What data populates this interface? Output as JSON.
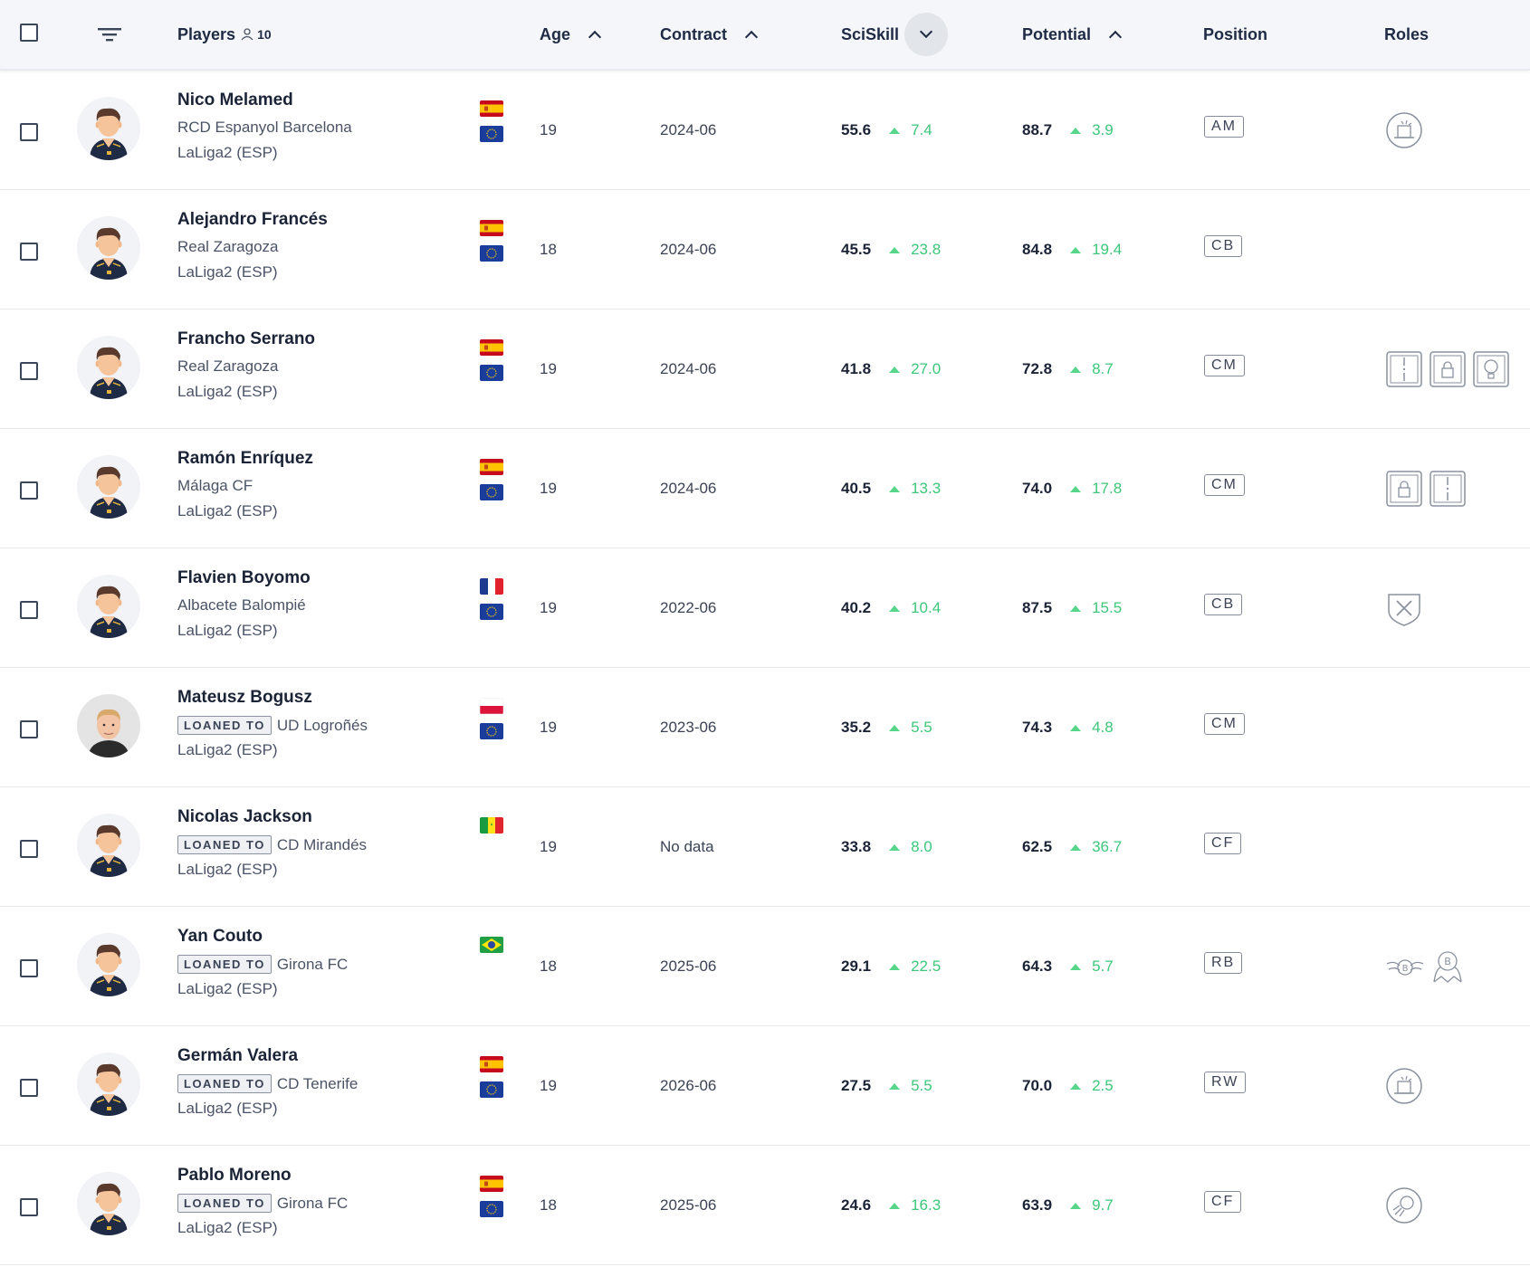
{
  "header": {
    "players_label": "Players",
    "players_count": "10",
    "age_label": "Age",
    "contract_label": "Contract",
    "sciskill_label": "SciSkill",
    "potential_label": "Potential",
    "position_label": "Position",
    "roles_label": "Roles"
  },
  "loan_label": "LOANED TO",
  "rows": [
    {
      "name": "Nico Melamed",
      "club": "RCD Espanyol Barcelona",
      "loaned": false,
      "league": "LaLiga2 (ESP)",
      "flags": [
        "spain-flag",
        "eu-flag"
      ],
      "age": "19",
      "contract": "2024-06",
      "sciskill": "55.6",
      "sciskill_delta": "7.4",
      "potential": "88.7",
      "potential_delta": "3.9",
      "position": "AM",
      "roles": [
        "magician-hat-icon"
      ]
    },
    {
      "name": "Alejandro Francés",
      "club": "Real Zaragoza",
      "loaned": false,
      "league": "LaLiga2 (ESP)",
      "flags": [
        "spain-flag",
        "eu-flag"
      ],
      "age": "18",
      "contract": "2024-06",
      "sciskill": "45.5",
      "sciskill_delta": "23.8",
      "potential": "84.8",
      "potential_delta": "19.4",
      "position": "CB",
      "roles": []
    },
    {
      "name": "Francho Serrano",
      "club": "Real Zaragoza",
      "loaned": false,
      "league": "LaLiga2 (ESP)",
      "flags": [
        "spain-flag",
        "eu-flag"
      ],
      "age": "19",
      "contract": "2024-06",
      "sciskill": "41.8",
      "sciskill_delta": "27.0",
      "potential": "72.8",
      "potential_delta": "8.7",
      "position": "CM",
      "roles": [
        "pitch-line-icon",
        "lock-icon",
        "lightbulb-icon"
      ]
    },
    {
      "name": "Ramón Enríquez",
      "club": "Málaga CF",
      "loaned": false,
      "league": "LaLiga2 (ESP)",
      "flags": [
        "spain-flag",
        "eu-flag"
      ],
      "age": "19",
      "contract": "2024-06",
      "sciskill": "40.5",
      "sciskill_delta": "13.3",
      "potential": "74.0",
      "potential_delta": "17.8",
      "position": "CM",
      "roles": [
        "lock-icon",
        "pitch-line-icon"
      ]
    },
    {
      "name": "Flavien Boyomo",
      "club": "Albacete Balompié",
      "loaned": false,
      "league": "LaLiga2 (ESP)",
      "flags": [
        "france-flag",
        "eu-flag"
      ],
      "age": "19",
      "contract": "2022-06",
      "sciskill": "40.2",
      "sciskill_delta": "10.4",
      "potential": "87.5",
      "potential_delta": "15.5",
      "position": "CB",
      "roles": [
        "shield-crossed-icon"
      ]
    },
    {
      "name": "Mateusz Bogusz",
      "club": "UD Logroñés",
      "loaned": true,
      "league": "LaLiga2 (ESP)",
      "flags": [
        "poland-flag",
        "eu-flag"
      ],
      "age": "19",
      "contract": "2023-06",
      "sciskill": "35.2",
      "sciskill_delta": "5.5",
      "potential": "74.3",
      "potential_delta": "4.8",
      "position": "CM",
      "roles": [],
      "photo": true
    },
    {
      "name": "Nicolas Jackson",
      "club": "CD Mirandés",
      "loaned": true,
      "league": "LaLiga2 (ESP)",
      "flags": [
        "senegal-flag"
      ],
      "age": "19",
      "contract": "No data",
      "sciskill": "33.8",
      "sciskill_delta": "8.0",
      "potential": "62.5",
      "potential_delta": "36.7",
      "position": "CF",
      "roles": []
    },
    {
      "name": "Yan Couto",
      "club": "Girona FC",
      "loaned": true,
      "league": "LaLiga2 (ESP)",
      "flags": [
        "brazil-flag"
      ],
      "age": "18",
      "contract": "2025-06",
      "sciskill": "29.1",
      "sciskill_delta": "22.5",
      "potential": "64.3",
      "potential_delta": "5.7",
      "position": "RB",
      "roles": [
        "winged-badge-icon",
        "hooded-badge-icon"
      ]
    },
    {
      "name": "Germán Valera",
      "club": "CD Tenerife",
      "loaned": true,
      "league": "LaLiga2 (ESP)",
      "flags": [
        "spain-flag",
        "eu-flag"
      ],
      "age": "19",
      "contract": "2026-06",
      "sciskill": "27.5",
      "sciskill_delta": "5.5",
      "potential": "70.0",
      "potential_delta": "2.5",
      "position": "RW",
      "roles": [
        "magician-hat-icon"
      ]
    },
    {
      "name": "Pablo Moreno",
      "club": "Girona FC",
      "loaned": true,
      "league": "LaLiga2 (ESP)",
      "flags": [
        "spain-flag",
        "eu-flag"
      ],
      "age": "18",
      "contract": "2025-06",
      "sciskill": "24.6",
      "sciskill_delta": "16.3",
      "potential": "63.9",
      "potential_delta": "9.7",
      "position": "CF",
      "roles": [
        "rocket-ball-icon"
      ]
    }
  ]
}
